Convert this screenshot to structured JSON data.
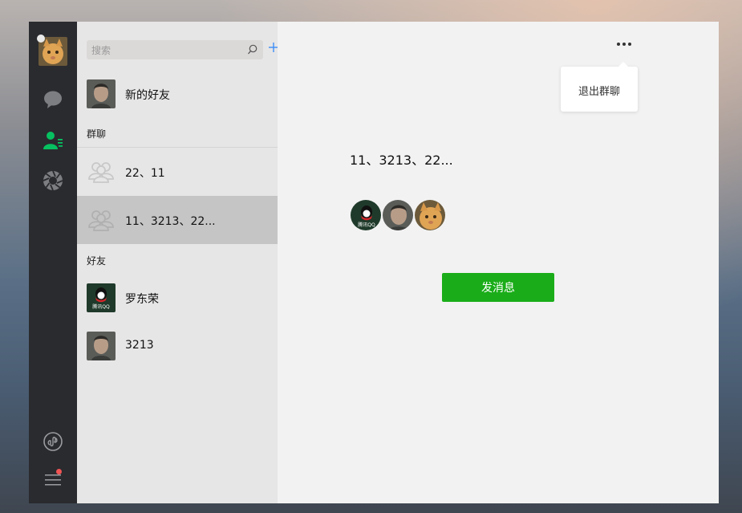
{
  "search": {
    "placeholder": "搜索"
  },
  "list": {
    "new_friends": {
      "label": "新的好友"
    },
    "groups_title": "群聊",
    "groups": [
      {
        "label": "22、11"
      },
      {
        "label": "11、3213、22..."
      }
    ],
    "friends_title": "好友",
    "friends": [
      {
        "label": "罗东荣"
      },
      {
        "label": "3213"
      }
    ]
  },
  "avatar_badge_text": "腾讯QQ",
  "main": {
    "menu_item": "退出群聊",
    "group_name": "11、3213、22...",
    "send_button": "发消息"
  },
  "colors": {
    "accent_green": "#1aad19",
    "nav_active_green": "#07c160",
    "sidebar_dark": "#2a2b2f",
    "badge_red": "#f25454",
    "selected_row": "#c5c5c5"
  },
  "icons": [
    "chat-icon",
    "contacts-icon",
    "moments-icon",
    "mini-program-icon",
    "menu-icon",
    "search-icon",
    "add-icon",
    "more-icon",
    "group-avatar-icon"
  ]
}
